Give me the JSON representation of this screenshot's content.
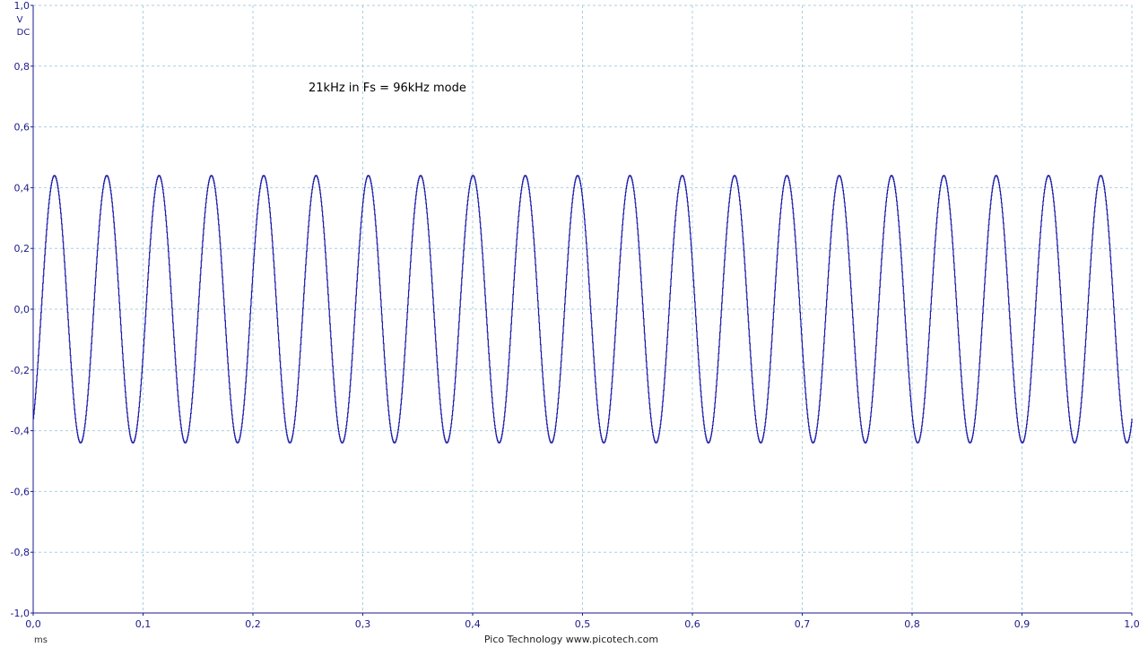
{
  "chart_data": {
    "type": "line",
    "title": "21kHz in Fs = 96kHz mode",
    "xlabel": "ms",
    "ylabel": "V",
    "ylabel_coupling": "DC",
    "footer": "Pico Technology   www.picotech.com",
    "xlim": [
      0.0,
      1.0
    ],
    "ylim": [
      -1.0,
      1.0
    ],
    "x_ticks": [
      0.0,
      0.1,
      0.2,
      0.3,
      0.4,
      0.5,
      0.6,
      0.7,
      0.8,
      0.9,
      1.0
    ],
    "y_ticks": [
      1.0,
      0.8,
      0.6,
      0.4,
      0.2,
      0.0,
      -0.2,
      -0.4,
      -0.6,
      -0.8,
      -1.0
    ],
    "x_tick_labels": [
      "0,0",
      "0,1",
      "0,2",
      "0,3",
      "0,4",
      "0,5",
      "0,6",
      "0,7",
      "0,8",
      "0,9",
      "1,0"
    ],
    "y_tick_labels": [
      "1,0",
      "0,8",
      "0,6",
      "0,4",
      "0,2",
      "0,0",
      "-0,2",
      "-0,4",
      "-0,6",
      "-0,8",
      "-1,0"
    ],
    "grid": true,
    "line_color": "#1a1aa8",
    "grid_color": "#a8d0e0",
    "axis_color": "#1a1a8c",
    "series": [
      {
        "signal": "sine",
        "frequency_khz": 21,
        "sample_rate_khz": 96,
        "amplitude_v": 0.44,
        "offset_v": 0.0,
        "start_value_v": -0.36,
        "peak_times_ms": [
          0.02,
          0.068,
          0.115,
          0.163,
          0.211,
          0.258,
          0.306,
          0.354,
          0.401,
          0.449,
          0.497,
          0.544,
          0.592,
          0.639,
          0.687,
          0.735,
          0.782,
          0.83,
          0.878,
          0.925,
          0.973
        ],
        "trough_times_ms": [
          0.044,
          0.092,
          0.139,
          0.187,
          0.234,
          0.282,
          0.33,
          0.377,
          0.425,
          0.473,
          0.52,
          0.568,
          0.616,
          0.663,
          0.711,
          0.759,
          0.806,
          0.854,
          0.901,
          0.949,
          0.997
        ]
      }
    ]
  }
}
